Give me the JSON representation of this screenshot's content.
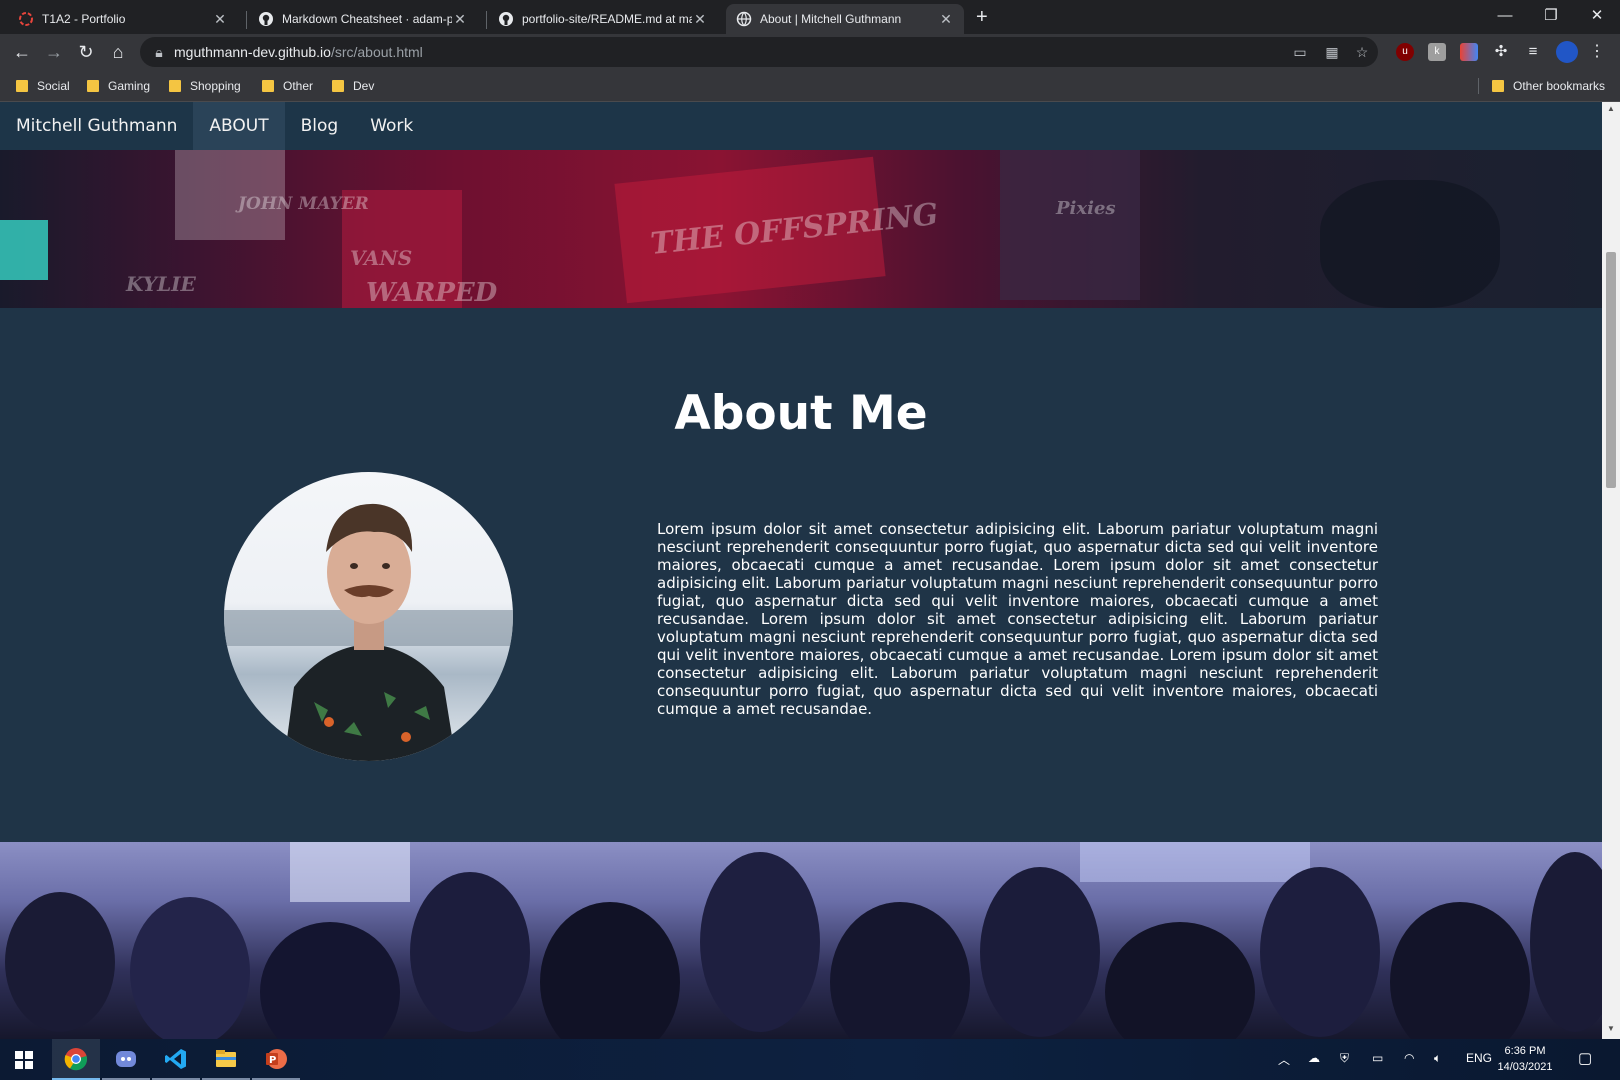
{
  "browser": {
    "tabs": [
      {
        "title": "T1A2 - Portfolio",
        "active": false
      },
      {
        "title": "Markdown Cheatsheet · adam-p/",
        "active": false
      },
      {
        "title": "portfolio-site/README.md at ma",
        "active": false
      },
      {
        "title": "About | Mitchell Guthmann",
        "active": true
      }
    ],
    "url_host": "mguthmann-dev.github.io",
    "url_path": "/src/about.html",
    "bookmarks": [
      "Social",
      "Gaming",
      "Shopping",
      "Other",
      "Dev"
    ],
    "other_bookmarks": "Other bookmarks"
  },
  "site": {
    "brand": "Mitchell Guthmann",
    "nav": [
      "ABOUT",
      "Blog",
      "Work"
    ],
    "hero_texts": [
      "JOHN MAYER",
      "VANS",
      "WARPED",
      "Pixies",
      "KYLIE",
      "THE OFFSPRING"
    ]
  },
  "about": {
    "title": "About Me",
    "body": "Lorem ipsum dolor sit amet consectetur adipisicing elit. Laborum pariatur voluptatum magni nesciunt reprehenderit consequuntur porro fugiat, quo aspernatur dicta sed qui velit inventore maiores, obcaecati cumque a amet recusandae. Lorem ipsum dolor sit amet consectetur adipisicing elit. Laborum pariatur voluptatum magni nesciunt reprehenderit consequuntur porro fugiat, quo aspernatur dicta sed qui velit inventore maiores, obcaecati cumque a amet recusandae. Lorem ipsum dolor sit amet consectetur adipisicing elit. Laborum pariatur voluptatum magni nesciunt reprehenderit consequuntur porro fugiat, quo aspernatur dicta sed qui velit inventore maiores, obcaecati cumque a amet recusandae. Lorem ipsum dolor sit amet consectetur adipisicing elit. Laborum pariatur voluptatum magni nesciunt reprehenderit consequuntur porro fugiat, quo aspernatur dicta sed qui velit inventore maiores, obcaecati cumque a amet recusandae."
  },
  "taskbar": {
    "apps": [
      "start-icon",
      "chrome-icon",
      "discord-icon",
      "vscode-icon",
      "file-explorer-icon",
      "powerpoint-icon"
    ],
    "language": "ENG",
    "time": "6:36 PM",
    "date": "14/03/2021"
  },
  "colors": {
    "page_bg": "#1f3447",
    "nav_bg": "#1d3548",
    "nav_active": "#2a4358",
    "text": "#ffffff"
  }
}
